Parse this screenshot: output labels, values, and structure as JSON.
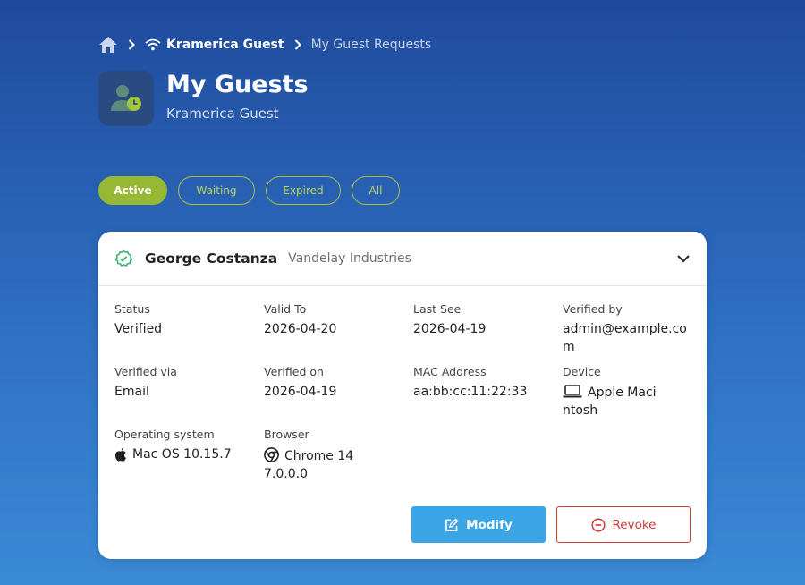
{
  "breadcrumb": {
    "org": "Kramerica Guest",
    "current": "My Guest Requests"
  },
  "header": {
    "title": "My Guests",
    "subtitle": "Kramerica Guest"
  },
  "filters": [
    {
      "label": "Active",
      "active": true
    },
    {
      "label": "Waiting",
      "active": false
    },
    {
      "label": "Expired",
      "active": false
    },
    {
      "label": "All",
      "active": false
    }
  ],
  "guest": {
    "name": "George Costanza",
    "company": "Vandelay Industries",
    "fields": {
      "status_label": "Status",
      "status_value": "Verified",
      "valid_to_label": "Valid To",
      "valid_to_value": "2026-04-20",
      "last_seen_label": "Last See",
      "last_seen_value": "2026-04-19",
      "verified_by_label": "Verified by",
      "verified_by_value": "admin@example.com",
      "verified_via_label": "Verified via",
      "verified_via_value": "Email",
      "verified_on_label": "Verified on",
      "verified_on_value": "2026-04-19",
      "mac_label": "MAC Address",
      "mac_value": "aa:bb:cc:11:22:33",
      "device_label": "Device",
      "device_value": "Apple Macintosh",
      "os_label": "Operating system",
      "os_value": "Mac OS 10.15.7",
      "browser_label": "Browser",
      "browser_value": "Chrome 147.0.0.0"
    },
    "actions": {
      "modify": "Modify",
      "revoke": "Revoke"
    }
  },
  "colors": {
    "accent_green": "#97b834",
    "modify_blue": "#3ca5e6",
    "revoke_red": "#cc3a3a",
    "verified_green": "#3cb371"
  }
}
